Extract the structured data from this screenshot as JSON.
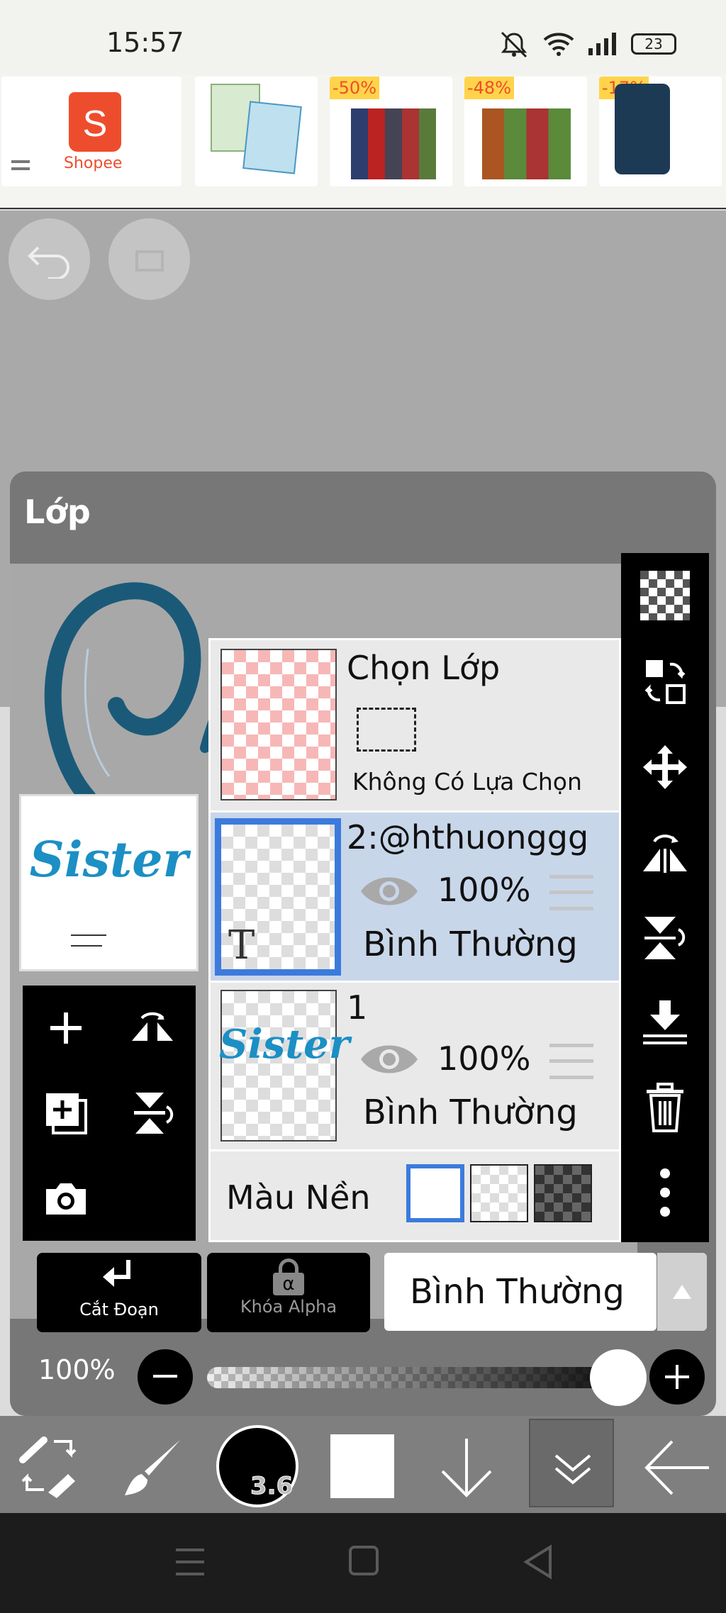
{
  "status_bar": {
    "time": "15:57",
    "battery": "23"
  },
  "ad_banner": {
    "brand": "Shopee",
    "discounts": [
      "-50%",
      "-48%",
      "-17%"
    ]
  },
  "panel": {
    "title": "Lớp",
    "layers": [
      {
        "name": "Chọn Lớp",
        "subtitle": "Không Có Lựa Chọn"
      },
      {
        "name": "2:@hthuonggg",
        "opacity": "100%",
        "mode": "Bình Thường",
        "selected": true,
        "type": "text",
        "thumb_letter": "T"
      },
      {
        "name": "1",
        "opacity": "100%",
        "mode": "Bình Thường",
        "selected": false,
        "preview_text": "Sister"
      }
    ],
    "background": {
      "label": "Màu Nền"
    },
    "preview_text": "Sister",
    "clip_label": "Cắt Đoạn",
    "alpha_lock_label": "Khóa Alpha",
    "alpha_symbol": "α",
    "blend_mode": "Bình Thường",
    "opacity": "100%",
    "opacity_fraction": 1.0
  },
  "bottom_toolbar": {
    "brush_size": "3.6"
  },
  "colors": {
    "accent": "#3c7bdc",
    "selected_row": "#c8d6ea",
    "teal_art": "#1a5a78",
    "shopee": "#ee4d2d"
  }
}
